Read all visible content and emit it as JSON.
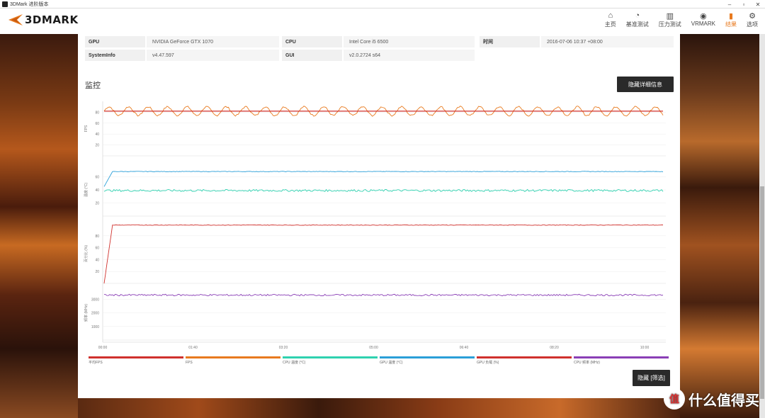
{
  "window": {
    "title": "3DMark 进阶版本"
  },
  "app": {
    "logo_text": "3DMARK"
  },
  "nav": [
    {
      "label": "主页",
      "icon": "home-icon",
      "glyph": "⌂"
    },
    {
      "label": "基准测试",
      "icon": "gauge-icon",
      "glyph": "◔"
    },
    {
      "label": "压力测试",
      "icon": "bar-chart-icon",
      "glyph": "▥"
    },
    {
      "label": "VRMARK",
      "icon": "vr-icon",
      "glyph": "◉"
    },
    {
      "label": "结果",
      "icon": "results-icon",
      "glyph": "▮"
    },
    {
      "label": "选项",
      "icon": "gear-icon",
      "glyph": "⚙"
    }
  ],
  "accent": "#e87a1f",
  "system_info": {
    "gpu_label": "GPU",
    "gpu_value": "NVIDIA GeForce GTX 1070",
    "cpu_label": "CPU",
    "cpu_value": "Intel Core i5 6500",
    "time_label": "时间",
    "time_value": "2016-07-06 10:37 +08:00",
    "sysinfo_label": "SystemInfo",
    "sysinfo_value": "v4.47.597",
    "gui_label": "GUI",
    "gui_value": "v2.0.2724 s64"
  },
  "monitor": {
    "title": "监控",
    "hide_details_button": "隐藏详细信息",
    "hide_filter_button": "隐藏 [筛选]"
  },
  "chart_data": {
    "type": "line",
    "x_ticks": [
      "00:00",
      "01:40",
      "03:20",
      "05:00",
      "06:40",
      "08:20",
      "10:00"
    ],
    "panels": [
      {
        "ylabel": "FPS",
        "yticks": [
          20,
          40,
          60,
          80
        ],
        "series": [
          {
            "name": "FPS",
            "color": "#e87a1f",
            "base": 82,
            "amp": 8
          },
          {
            "name": "平均FPS",
            "color": "#d0312d",
            "base": 82,
            "amp": 0
          }
        ]
      },
      {
        "ylabel": "温度 (°C)",
        "yticks": [
          20,
          40,
          60
        ],
        "series": [
          {
            "name": "GPU 温度 (°C)",
            "color": "#2b9fd8",
            "start": 45,
            "base": 68,
            "amp": 0.4
          },
          {
            "name": "CPU 温度 (°C)",
            "color": "#2fd1b0",
            "base": 39,
            "amp": 1.6
          }
        ]
      },
      {
        "ylabel": "百分比 (%)",
        "yticks": [
          20,
          40,
          60,
          80
        ],
        "series": [
          {
            "name": "GPU 负载 (%)",
            "color": "#d0312d",
            "start": 0,
            "base": 98,
            "amp": 0.5
          }
        ]
      },
      {
        "ylabel": "频率 (MHz)",
        "yticks": [
          1000,
          2000,
          3000
        ],
        "series": [
          {
            "name": "CPU 频率 (MHz)",
            "color": "#8a3fb6",
            "base": 3300,
            "amp": 60
          }
        ]
      }
    ],
    "legend": [
      {
        "name": "平均FPS",
        "color": "#d0312d"
      },
      {
        "name": "FPS",
        "color": "#e87a1f"
      },
      {
        "name": "CPU 温度 (°C)",
        "color": "#2fd1b0"
      },
      {
        "name": "GPU 温度 (°C)",
        "color": "#2b9fd8"
      },
      {
        "name": "GPU 负载 (%)",
        "color": "#d0312d"
      },
      {
        "name": "CPU 频率 (MHz)",
        "color": "#8a3fb6"
      }
    ]
  },
  "watermark": {
    "text": "什么值得买",
    "badge": "值"
  }
}
